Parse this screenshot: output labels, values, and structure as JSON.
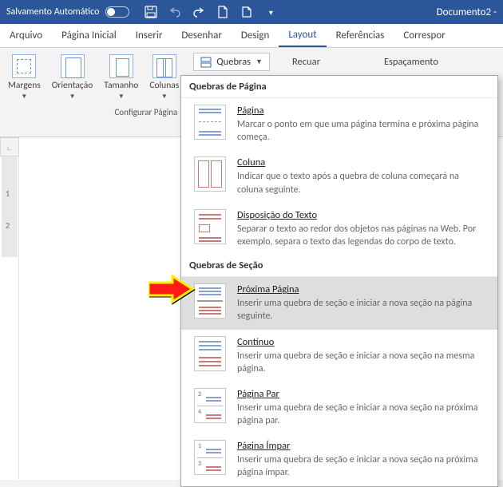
{
  "titlebar": {
    "autosave_label": "Salvamento Automático",
    "doc_title": "Documento2  -"
  },
  "tabs": {
    "arquivo": "Arquivo",
    "pagina_inicial": "Página Inicial",
    "inserir": "Inserir",
    "desenhar": "Desenhar",
    "design": "Design",
    "layout": "Layout",
    "referencias": "Referências",
    "correspon": "Correspor"
  },
  "ribbon": {
    "margens": "Margens",
    "orientacao": "Orientação",
    "tamanho": "Tamanho",
    "colunas": "Colunas",
    "group_caption": "Configurar Página",
    "quebras_btn": "Quebras",
    "recuar": "Recuar",
    "espacamento": "Espaçamento"
  },
  "ruler": {
    "tick1": "1",
    "tick2": "2"
  },
  "menu": {
    "section_page": "Quebras de Página",
    "section_section": "Quebras de Seção",
    "pagina": {
      "title": "Página",
      "desc": "Marcar o ponto em que uma página termina e próxima página começa."
    },
    "coluna": {
      "title": "Coluna",
      "desc": "Indicar que o texto após a quebra de coluna começará na coluna seguinte."
    },
    "disposicao": {
      "title": "Disposição do Texto",
      "desc": "Separar o texto ao redor dos objetos nas páginas na Web. Por exemplo, separa o texto das legendas do corpo de texto."
    },
    "proxima": {
      "title": "Próxima Página",
      "desc": "Inserir uma quebra de seção e iniciar a nova seção na página seguinte."
    },
    "continuo": {
      "title": "Contínuo",
      "desc": "Inserir uma quebra de seção e iniciar a nova seção na mesma página."
    },
    "par": {
      "title": "Página Par",
      "desc": "Inserir uma quebra de seção e iniciar a nova seção na próxima página par."
    },
    "impar": {
      "title": "Página Ímpar",
      "desc": "Inserir uma quebra de seção e iniciar a nova seção na próxima página ímpar."
    }
  }
}
